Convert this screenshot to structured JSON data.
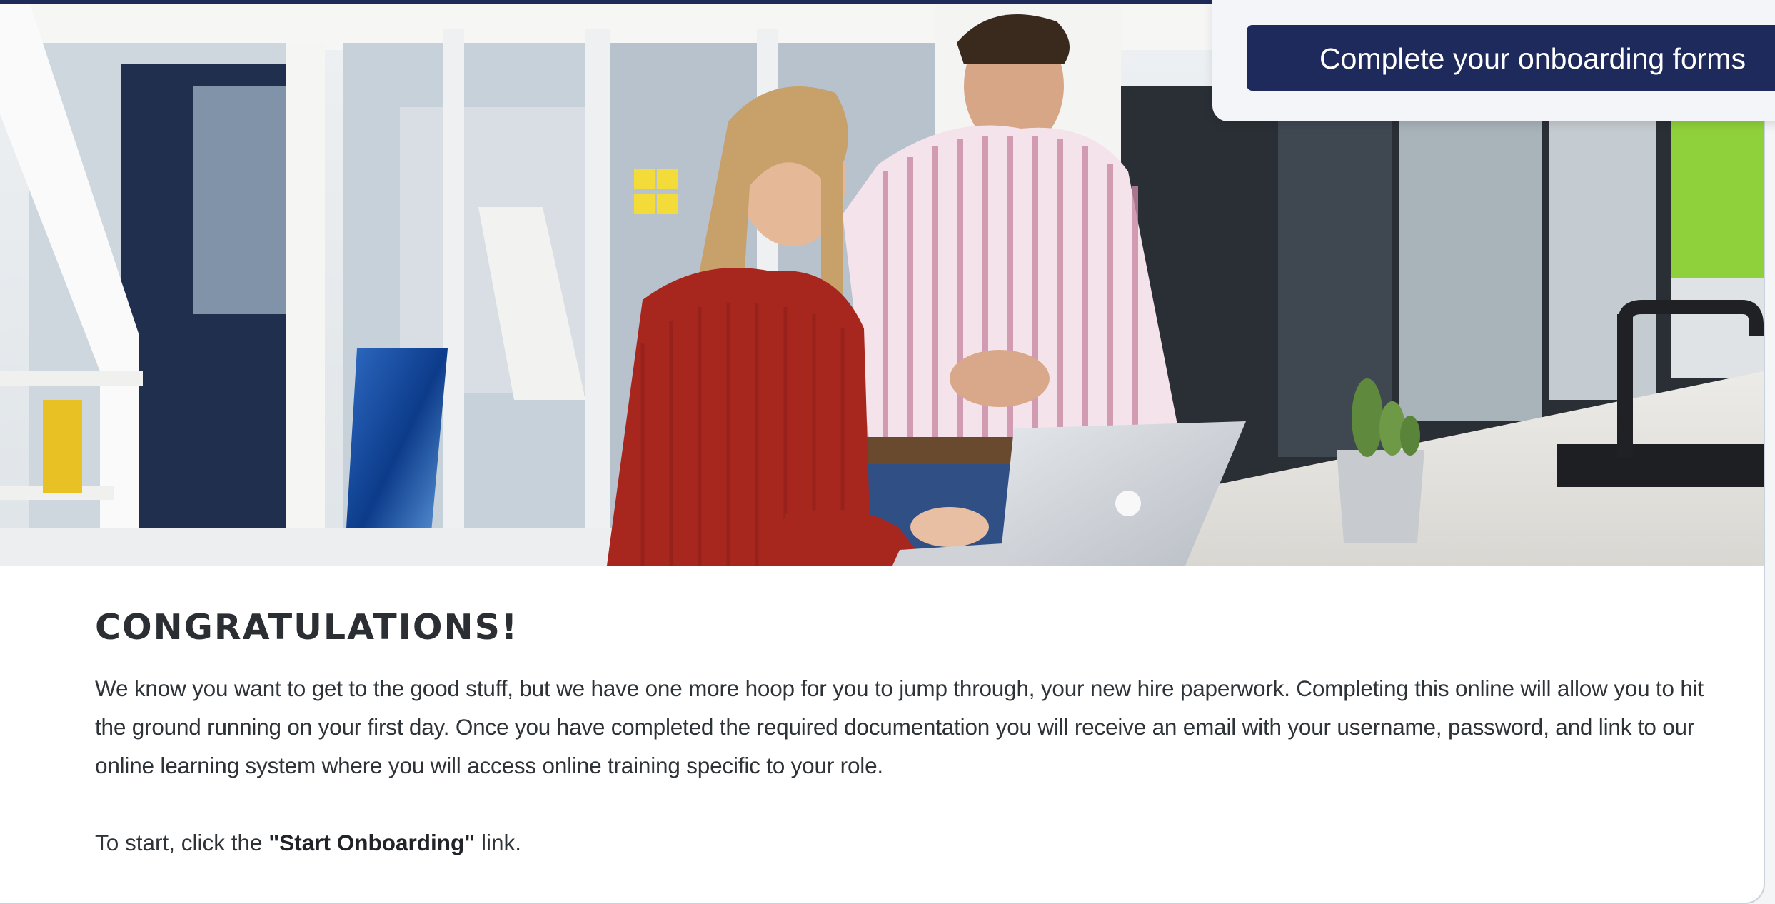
{
  "callout": {
    "button_label": "Complete your onboarding forms"
  },
  "hero": {
    "image_alt": "hero-office-photo"
  },
  "article": {
    "heading": "CONGRATULATIONS!",
    "body": "We know you want to get to the good stuff, but we have one more hoop for you to jump through, your new hire paperwork. Completing this online will allow you to hit the ground running on your first day. Once you have completed the required documentation you will receive an email with your username, password, and link to our online learning system where you will access online training specific to your role.",
    "start_prefix": "To start, click the ",
    "start_link_text": "\"Start Onboarding\"",
    "start_suffix": " link."
  },
  "colors": {
    "navy": "#1e2a5c",
    "heading_text": "#2b2f33",
    "body_text": "#2e3338"
  }
}
